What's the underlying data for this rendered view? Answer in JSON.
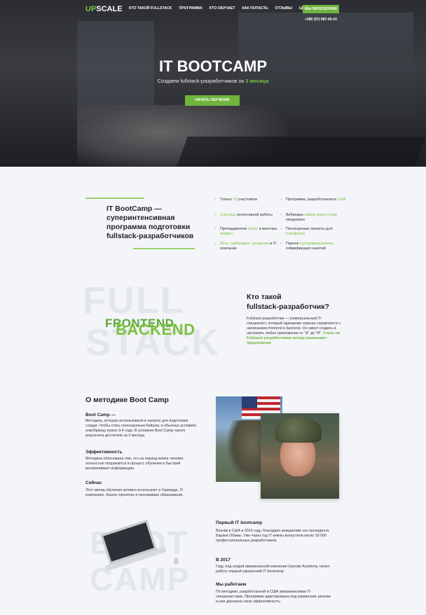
{
  "header": {
    "logo_up": "UP",
    "logo_rest": "SCALE",
    "nav": [
      "Кто такой Fullstack",
      "Программа",
      "Кто обучает",
      "Как попасть",
      "Отзывы",
      "Цена"
    ],
    "callback_label": "Мы перезвоним",
    "phone": "+380 (97) 987-65-43"
  },
  "hero": {
    "title": "IT BOOTCAMP",
    "subtitle_pre": "Создаем fullstack-разработчиков за",
    "subtitle_accent": "3 месяца",
    "cta_label": "Начать обучение"
  },
  "intro": {
    "title": "IT BootCamp — суперинтенсивная программа подготовки fullstack-разработчиков",
    "features_left": [
      {
        "pre": "Только ",
        "g": "18",
        "post": " участников"
      },
      {
        "pre": "",
        "g": "3 месяца",
        "post": " интенсивной работы"
      },
      {
        "pre": "Преподаватели ",
        "g": "senior",
        "post": " и менторы ",
        "g2": "middle+"
      },
      {
        "pre": "",
        "g": "Йога, тимбилдинг, экскурсии",
        "post": " в IT-компании"
      }
    ],
    "features_right": [
      {
        "pre": "Программа, разработанная в ",
        "g": "США",
        "post": ""
      },
      {
        "pre": "Вебинары ",
        "g": "живое присутствие",
        "post": " ежедневно"
      },
      {
        "pre": "Полноценные проекты для ",
        "g": "портфолио",
        "post": ""
      },
      {
        "pre": "Парное ",
        "g": "программирование",
        "post": ", геймификация занятий"
      }
    ]
  },
  "fullstack": {
    "bg_word_1": "FULL",
    "bg_word_2": "STACK",
    "frontend": "FRONTEND",
    "backend": "BACKEND",
    "heading_1": "Кто такой",
    "heading_2": "fullstack-разработчик?",
    "body": "Fullstack-разработчик — универсальный IT-специалист, который одинаково хорошо справляется с написанием frontend и backend. Он умеет создать и настроить любое приложение от \"А\" до \"Я\".",
    "body_accent": "Спрос на Fullstack-разработчиков всегда превышает предложение"
  },
  "method": {
    "title": "О методике Boot Camp",
    "blocks": [
      {
        "h": "Boot Camp —",
        "t": "Методика, которую использовали в лагерях для подготовки солдат. Чтобы стать полноценным бойцом, в обычных условиях новобранцу нужно 3-4 года. В условиях Boot Camp такого результата достигали за 3 месяца."
      },
      {
        "h": "Эффективность",
        "t": "Методика обоснована тем, что на период кемпа человек полностью погружается в процесс обучения и быстрей воспринимает информацию."
      },
      {
        "h": "Сейчас",
        "t": "Этот метод обучения активно используют в Гарварде, IT-компаниях, бизнес-проектах и программах образования."
      }
    ]
  },
  "bootcamp": {
    "bg_word_1": "BOOT",
    "bg_word_2": "CAMP",
    "blocks": [
      {
        "h": "Первый IT bootcamp",
        "t": "Возник в США в 2015 году, благодаря инициативе экс-президента Барака Обамы. Уже через год IT кемпы выпустили около 18 000 профессиональных разработчиков."
      },
      {
        "h": "В 2017",
        "t": "Году, под эгидой американской компании Upscale Academy, начал работу первый украинский IT bootcamp."
      },
      {
        "h": "Мы работаем",
        "t": "По методике, разработанной в США американскими IT-специалистами. Программа адаптирована под украинские реалии и уже доказала свою эффективность."
      }
    ]
  },
  "colors": {
    "accent": "#7cc242",
    "button": "#6fb43d",
    "hero_bg": "#2b2d33",
    "page_bg": "#f3f5f8"
  }
}
